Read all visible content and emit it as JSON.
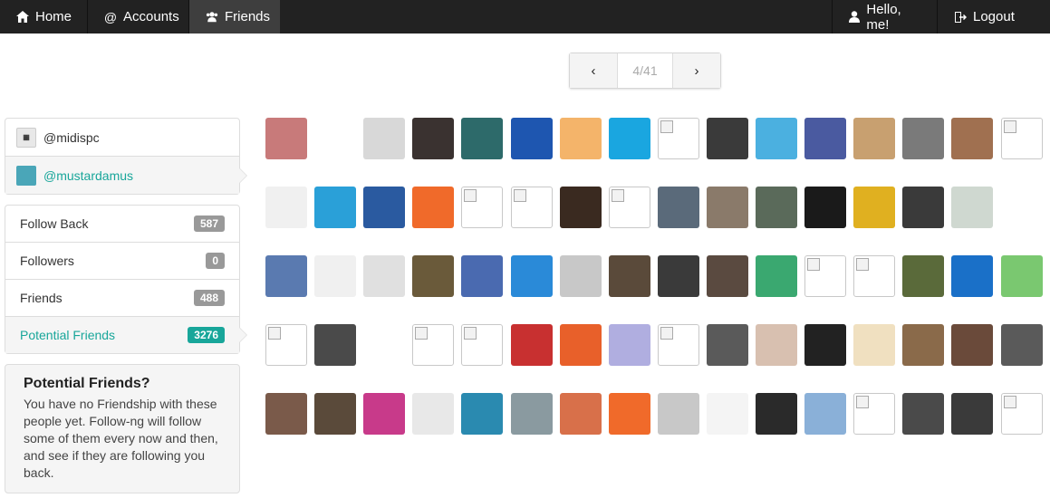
{
  "navbar": {
    "home": "Home",
    "accounts": "Accounts",
    "friends": "Friends",
    "user": "Hello, me!",
    "logout": "Logout"
  },
  "pager": {
    "current": "4/41",
    "prev": "‹",
    "next": "›"
  },
  "accounts": [
    {
      "handle": "@midispc",
      "avatar_color": "#e8e8e8"
    },
    {
      "handle": "@mustardamus",
      "avatar_color": "#4aa6b8"
    }
  ],
  "nav": [
    {
      "label": "Follow Back",
      "count": "587"
    },
    {
      "label": "Followers",
      "count": "0"
    },
    {
      "label": "Friends",
      "count": "488"
    },
    {
      "label": "Potential Friends",
      "count": "3276"
    }
  ],
  "info": {
    "title": "Potential Friends?",
    "text": "You have no Friendship with these people yet. Follow-ng will follow some of them every now and then, and see if they are following you back."
  },
  "avatars": [
    [
      "#c87a7a",
      "#ffffff",
      "#d8d8d8",
      "#3a3230",
      "#2d6a6a",
      "#1e56b0",
      "#f4b46a",
      "#1aa6e0",
      "broken",
      "#3a3a3a",
      "#4bb0e0",
      "#4a5aa0",
      "#c8a070",
      "#7a7a7a",
      "#a07050",
      "broken"
    ],
    [
      "#f0f0f0",
      "#2aa0d8",
      "#2a5aa0",
      "#f06a2a",
      "broken",
      "broken",
      "#3a2a20",
      "broken",
      "#5a6a7a",
      "#8a7a6a",
      "#5a6a5a",
      "#1a1a1a",
      "#e0b020",
      "#3a3a3a",
      "#cfd8d0",
      "#ffffff"
    ],
    [
      "#5a7ab0",
      "#f0f0f0",
      "#e0e0e0",
      "#6a5a3a",
      "#4a6ab0",
      "#2a8ad8",
      "#c8c8c8",
      "#5a4a3a",
      "#3a3a3a",
      "#5a4a40",
      "#3aa870",
      "broken",
      "broken",
      "#5a6a3a",
      "#1a70c8",
      "#7ac870"
    ],
    [
      "broken",
      "#4a4a4a",
      "#ffffff",
      "broken",
      "broken",
      "#c83030",
      "#e8602a",
      "#b0aee0",
      "broken",
      "#5a5a5a",
      "#d8c0b0",
      "#222222",
      "#f0e0c0",
      "#8a6a4a",
      "#6a4a3a",
      "#5a5a5a"
    ],
    [
      "#7a5a4a",
      "#5a4a3a",
      "#c83a8a",
      "#e8e8e8",
      "#2a8ab0",
      "#8a9aa0",
      "#d8704a",
      "#f06a2a",
      "#c8c8c8",
      "#f4f4f4",
      "#2a2a2a",
      "#8ab0d8",
      "broken",
      "#4a4a4a",
      "#3a3a3a",
      "broken"
    ]
  ]
}
